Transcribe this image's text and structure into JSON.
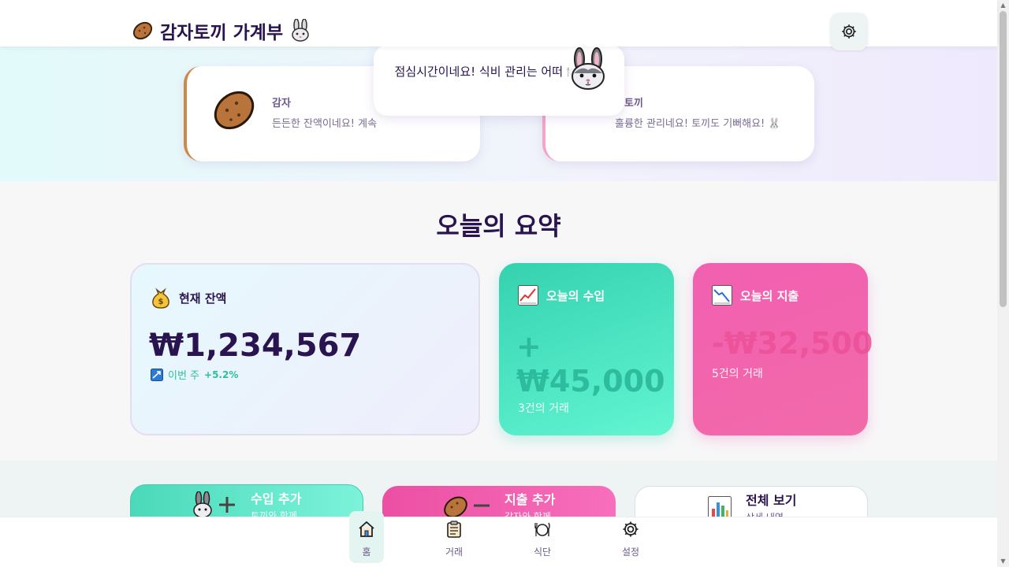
{
  "app": {
    "title": "감자토끼 가계부",
    "title_prefix_emoji": "🥔",
    "title_suffix_emoji": "🐰"
  },
  "header": {
    "settings_icon": "gear-icon"
  },
  "characters": {
    "potato": {
      "name": "감자",
      "message": "든든한 잔액이네요! 계속",
      "icon": "potato-icon"
    },
    "bunny": {
      "name": "토끼",
      "message": "훌륭한 관리네요! 토끼도 기뻐해요! 🐰",
      "icon": "bunny-icon"
    }
  },
  "speech_bubble": {
    "text": "점심시간이네요! 식비 관리는 어떠 🍽️"
  },
  "summary": {
    "title": "오늘의 요약",
    "balance": {
      "label": "현재 잔액",
      "icon": "money-bag-icon",
      "amount": "₩1,234,567",
      "trend_label": "이번 주",
      "trend_value": "+5.2%"
    },
    "income": {
      "label": "오늘의 수입",
      "icon": "chart-up-icon",
      "amount": "+ ₩45,000",
      "count": "3건의 거래"
    },
    "expense": {
      "label": "오늘의 지출",
      "icon": "chart-down-icon",
      "amount": "-₩32,500",
      "count": "5건의 거래"
    }
  },
  "actions": {
    "add_income": {
      "title": "수입 추가",
      "subtitle": "토끼와 함께"
    },
    "add_expense": {
      "title": "지출 추가",
      "subtitle": "감자와 함께"
    },
    "view_all": {
      "title": "전체 보기",
      "subtitle": "상세 내역"
    }
  },
  "bottom_nav": [
    {
      "label": "홈",
      "icon": "home-icon",
      "active": true
    },
    {
      "label": "거래",
      "icon": "clipboard-icon",
      "active": false
    },
    {
      "label": "식단",
      "icon": "plate-icon",
      "active": false
    },
    {
      "label": "설정",
      "icon": "gear-icon",
      "active": false
    }
  ],
  "colors": {
    "accent_mint": "#35d2b0",
    "accent_pink": "#f25fb1",
    "text_dark": "#2a1450",
    "potato_brown": "#cd8a45"
  }
}
